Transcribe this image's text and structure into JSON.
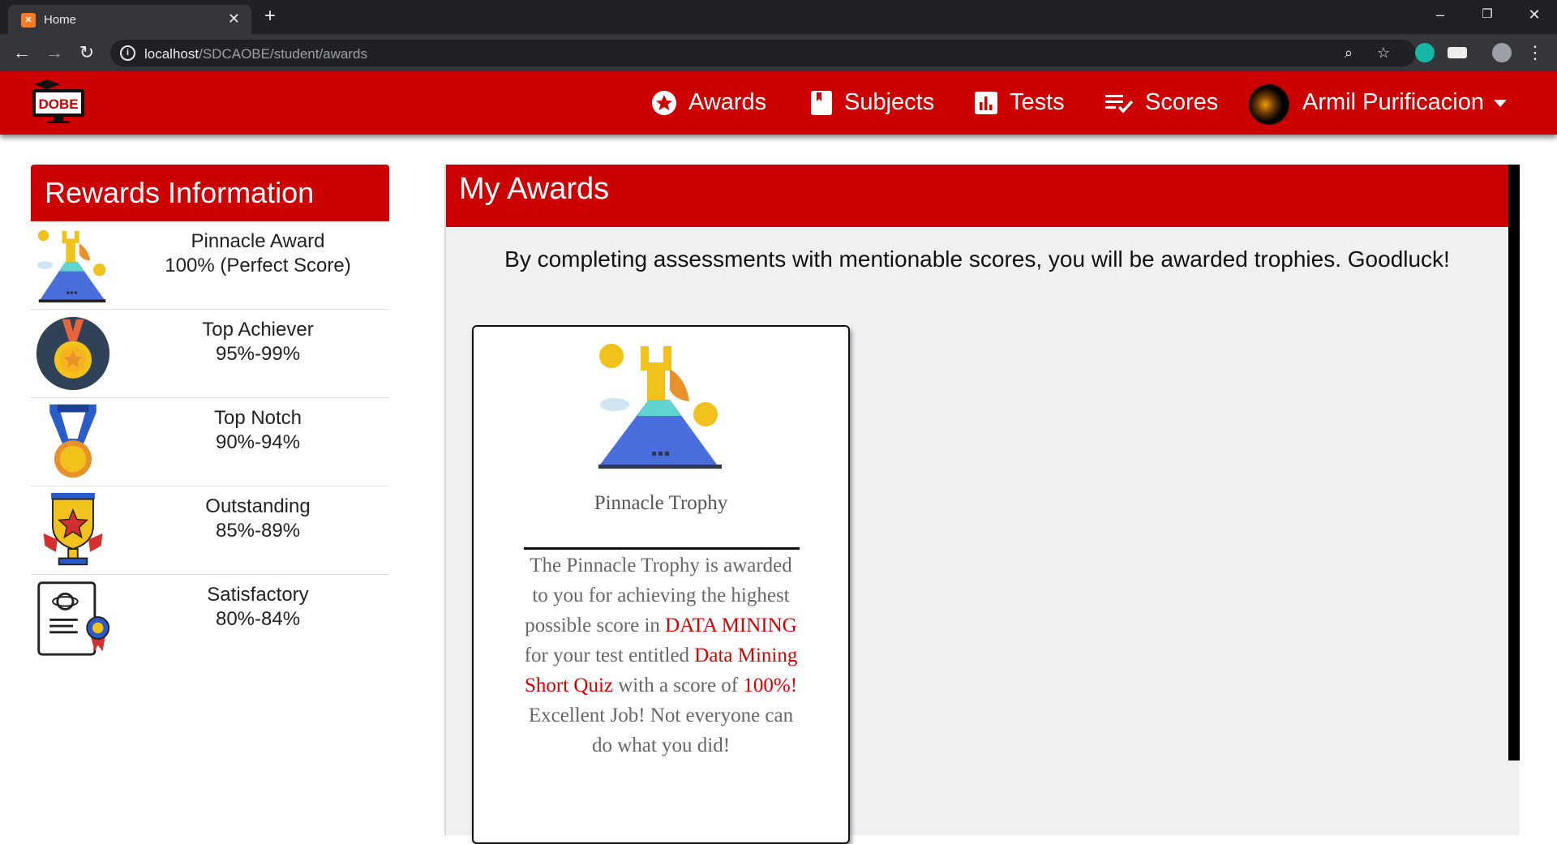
{
  "browser": {
    "tab_title": "Home",
    "tab_favicon_text": "✕",
    "url_host": "localhost",
    "url_path": "/SDCAOBE/student/awards"
  },
  "site": {
    "logo_text": "DOBE",
    "nav": [
      {
        "label": "Awards",
        "icon": "star-circle-icon"
      },
      {
        "label": "Subjects",
        "icon": "bookmark-book-icon"
      },
      {
        "label": "Tests",
        "icon": "bar-chart-icon"
      },
      {
        "label": "Scores",
        "icon": "checklist-icon"
      }
    ],
    "user_name": "Armil  Purificacion"
  },
  "rewards": {
    "title": "Rewards Information",
    "items": [
      {
        "name": "Pinnacle Award",
        "range": "100% (Perfect Score)",
        "icon": "mountain-summit-icon"
      },
      {
        "name": "Top Achiever",
        "range": "95%-99%",
        "icon": "medal-round-icon"
      },
      {
        "name": "Top Notch",
        "range": "90%-94%",
        "icon": "ribbon-medal-icon"
      },
      {
        "name": "Outstanding",
        "range": "85%-89%",
        "icon": "star-trophy-icon"
      },
      {
        "name": "Satisfactory",
        "range": "80%-84%",
        "icon": "certificate-icon"
      }
    ]
  },
  "awards": {
    "title": "My Awards",
    "subtitle": "By completing assessments with mentionable scores, you will be awarded trophies. Goodluck!",
    "trophy": {
      "name": "Pinnacle Trophy",
      "desc_1": "The Pinnacle Trophy is awarded to you for achieving the highest possible score in ",
      "subject": "DATA MINING",
      "desc_2": " for your test entitled ",
      "test": "Data Mining Short Quiz",
      "desc_3": " with a score of ",
      "score": "100%!",
      "desc_4": " Excellent Job! Not everyone can do what you did!"
    }
  },
  "colors": {
    "brand_red": "#cc0000",
    "highlight_red": "#d60000"
  }
}
